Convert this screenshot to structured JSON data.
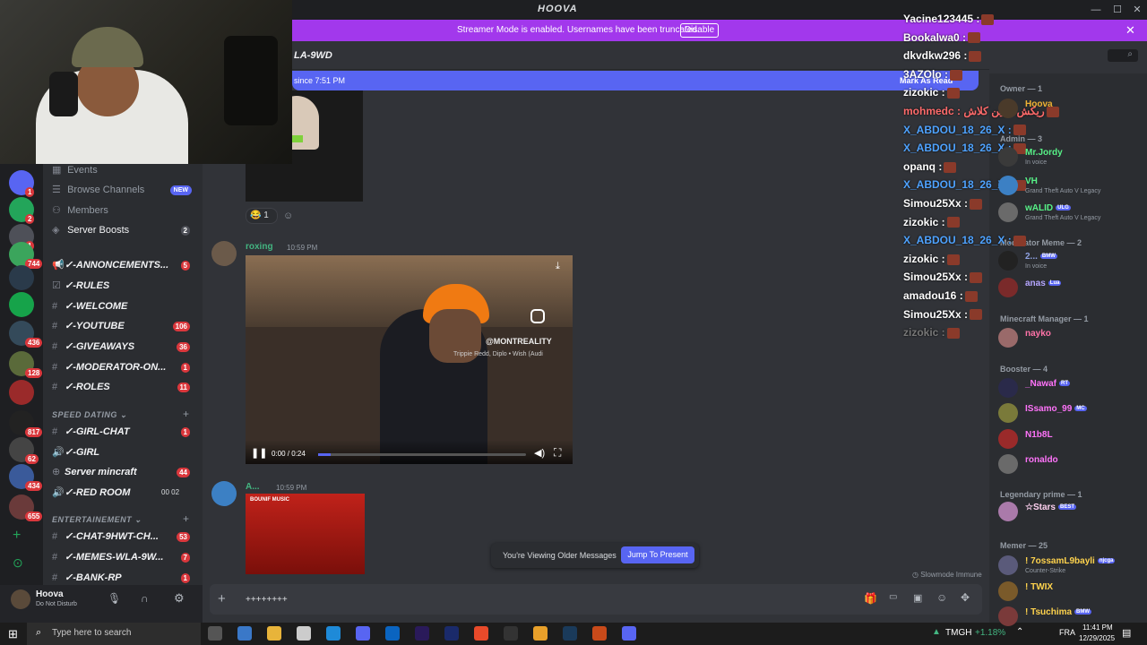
{
  "app": {
    "title": "HOOVA"
  },
  "banner": {
    "text": "Streamer Mode is enabled. Usernames have been truncated.",
    "button": "Disable"
  },
  "header": {
    "channel_fragment": "LA-9WD",
    "new_messages_text": "since 7:51 PM",
    "mark_as_read": "Mark As Read"
  },
  "servers": [
    {
      "badge": "1"
    },
    {
      "badge": "2"
    },
    {
      "badge": "1"
    },
    {
      "badge": "744"
    },
    {
      "badge": ""
    },
    {
      "badge": ""
    },
    {
      "badge": "436"
    },
    {
      "badge": "128"
    },
    {
      "badge": ""
    },
    {
      "badge": "817"
    },
    {
      "badge": "62"
    },
    {
      "badge": "434"
    },
    {
      "badge": "655"
    }
  ],
  "channels": {
    "events": "Events",
    "browse": "Browse Channels",
    "browse_badge": "NEW",
    "members": "Members",
    "boosts": "Server Boosts",
    "boosts_badge": "2",
    "list": [
      {
        "name": "✓-ANNONCEMENTS...",
        "badge": "5"
      },
      {
        "name": "✓-RULES",
        "badge": ""
      },
      {
        "name": "✓-WELCOME",
        "badge": ""
      },
      {
        "name": "✓-YOUTUBE",
        "badge": "106"
      },
      {
        "name": "✓-GIVEAWAYS",
        "badge": "36"
      },
      {
        "name": "✓-MODERATOR-ON...",
        "badge": "1"
      },
      {
        "name": "✓-ROLES",
        "badge": "11"
      }
    ],
    "cat_speed": "SPEED DATING",
    "speed_list": [
      {
        "name": "✓-GIRL-CHAT",
        "badge": "1"
      },
      {
        "name": "✓-GIRL",
        "badge": ""
      },
      {
        "name": "Server mincraft",
        "badge": "44"
      },
      {
        "name": "✓-RED ROOM",
        "badge": ""
      }
    ],
    "red_room_counts": "00 02",
    "cat_ent": "ENTERTAINEMENT",
    "ent_list": [
      {
        "name": "✓-CHAT-9HWT-CH...",
        "badge": "53"
      },
      {
        "name": "✓-MEMES-WLA-9W...",
        "badge": "7"
      },
      {
        "name": "✓-BANK-RP",
        "badge": "1"
      }
    ]
  },
  "user": {
    "name": "Hoova",
    "status": "Do Not Disturb"
  },
  "messages": [
    {
      "reaction_count": "1"
    },
    {
      "author": "roxing",
      "time": "10:59 PM",
      "video_time": "0:00 / 0:24",
      "watermark": "@MONTREALITY",
      "watermark_sub": "Trippie Redd, Diplo • Wish (Audi"
    },
    {
      "author": "A...",
      "time": "10:59 PM",
      "card_title": "BOUNIF MUSIC"
    }
  ],
  "older": {
    "text": "You're Viewing Older Messages",
    "button": "Jump To Present"
  },
  "slowmode": "Slowmode Immune",
  "composer": {
    "value": "++++++++"
  },
  "stream_chat": [
    {
      "user": "Yacine123445 :",
      "color": "#ffffff"
    },
    {
      "user": "Bookalwa0 :",
      "color": "#ffffff"
    },
    {
      "user": "dkvdkw296 :",
      "color": "#ffffff"
    },
    {
      "user": "3AZOlo :",
      "color": "#ffffff"
    },
    {
      "user": "zizokic :",
      "color": "#ffffff"
    },
    {
      "user": "mohmedc : ريكش ديبين كلاش",
      "color": "#ff6b6b"
    },
    {
      "user": "X_ABDOU_18_26_X :",
      "color": "#4fa3ff"
    },
    {
      "user": "X_ABDOU_18_26_X :",
      "color": "#4fa3ff"
    },
    {
      "user": "opanq :",
      "color": "#ffffff"
    },
    {
      "user": "X_ABDOU_18_26_X :",
      "color": "#4fa3ff"
    },
    {
      "user": "Simou25Xx :",
      "color": "#ffffff"
    },
    {
      "user": "zizokic :",
      "color": "#ffffff"
    },
    {
      "user": "X_ABDOU_18_26_X :",
      "color": "#4fa3ff"
    },
    {
      "user": "zizokic :",
      "color": "#ffffff"
    },
    {
      "user": "Simou25Xx :",
      "color": "#ffffff"
    },
    {
      "user": "amadou16 :",
      "color": "#ffffff"
    },
    {
      "user": "Simou25Xx :",
      "color": "#ffffff"
    },
    {
      "user": "zizokic :",
      "color": "#777777"
    }
  ],
  "member_groups": {
    "owner": "Owner — 1",
    "admin": "Admin — 3",
    "moderator": "Moderator Meme — 2",
    "minecraft": "Minecraft Manager — 1",
    "booster": "Booster — 4",
    "legendary": "Legendary prime — 1",
    "memer": "Memer — 25"
  },
  "members": [
    {
      "name": "Hoova",
      "sub": "",
      "color": "#f0b232"
    },
    {
      "name": "Mr.Jordy",
      "sub": "In voice",
      "color": "#57f287"
    },
    {
      "name": "VH",
      "sub": "Grand Theft Auto V Legacy",
      "color": "#57f287"
    },
    {
      "name": "wALID",
      "sub": "Grand Theft Auto V Legacy",
      "color": "#57f287",
      "tag": "ULG"
    },
    {
      "name": "2...",
      "sub": "In voice",
      "color": "#8ea1e1",
      "tag": "BMW"
    },
    {
      "name": "anas",
      "sub": "",
      "color": "#b5a6ff",
      "tag": "Lua"
    },
    {
      "name": "nayko",
      "sub": "",
      "color": "#ff73a8"
    },
    {
      "name": "_Nawaf",
      "sub": "",
      "color": "#ff73fa",
      "tag": "RT"
    },
    {
      "name": "ISsamo_99",
      "sub": "",
      "color": "#ff73fa",
      "tag": "MC"
    },
    {
      "name": "N1b8L",
      "sub": "",
      "color": "#ff73fa"
    },
    {
      "name": "ronaldo",
      "sub": "",
      "color": "#ff73fa"
    },
    {
      "name": "☆Stars",
      "sub": "",
      "color": "#ffd1f0",
      "tag": "BEST"
    },
    {
      "name": "! 7ossamL9bayli",
      "sub": "Counter-Strike",
      "color": "#ffd34d",
      "tag": "njcga"
    },
    {
      "name": "! TWIX",
      "sub": "",
      "color": "#ffd34d"
    },
    {
      "name": "! Tsuchima",
      "sub": "",
      "color": "#ffd34d",
      "tag": "BMW"
    }
  ],
  "taskbar": {
    "search_placeholder": "Type here to search",
    "ticker": "TMGH",
    "ticker_change": "+1.18%",
    "lang": "FRA",
    "time": "11:41 PM",
    "date": "12/29/2025"
  }
}
